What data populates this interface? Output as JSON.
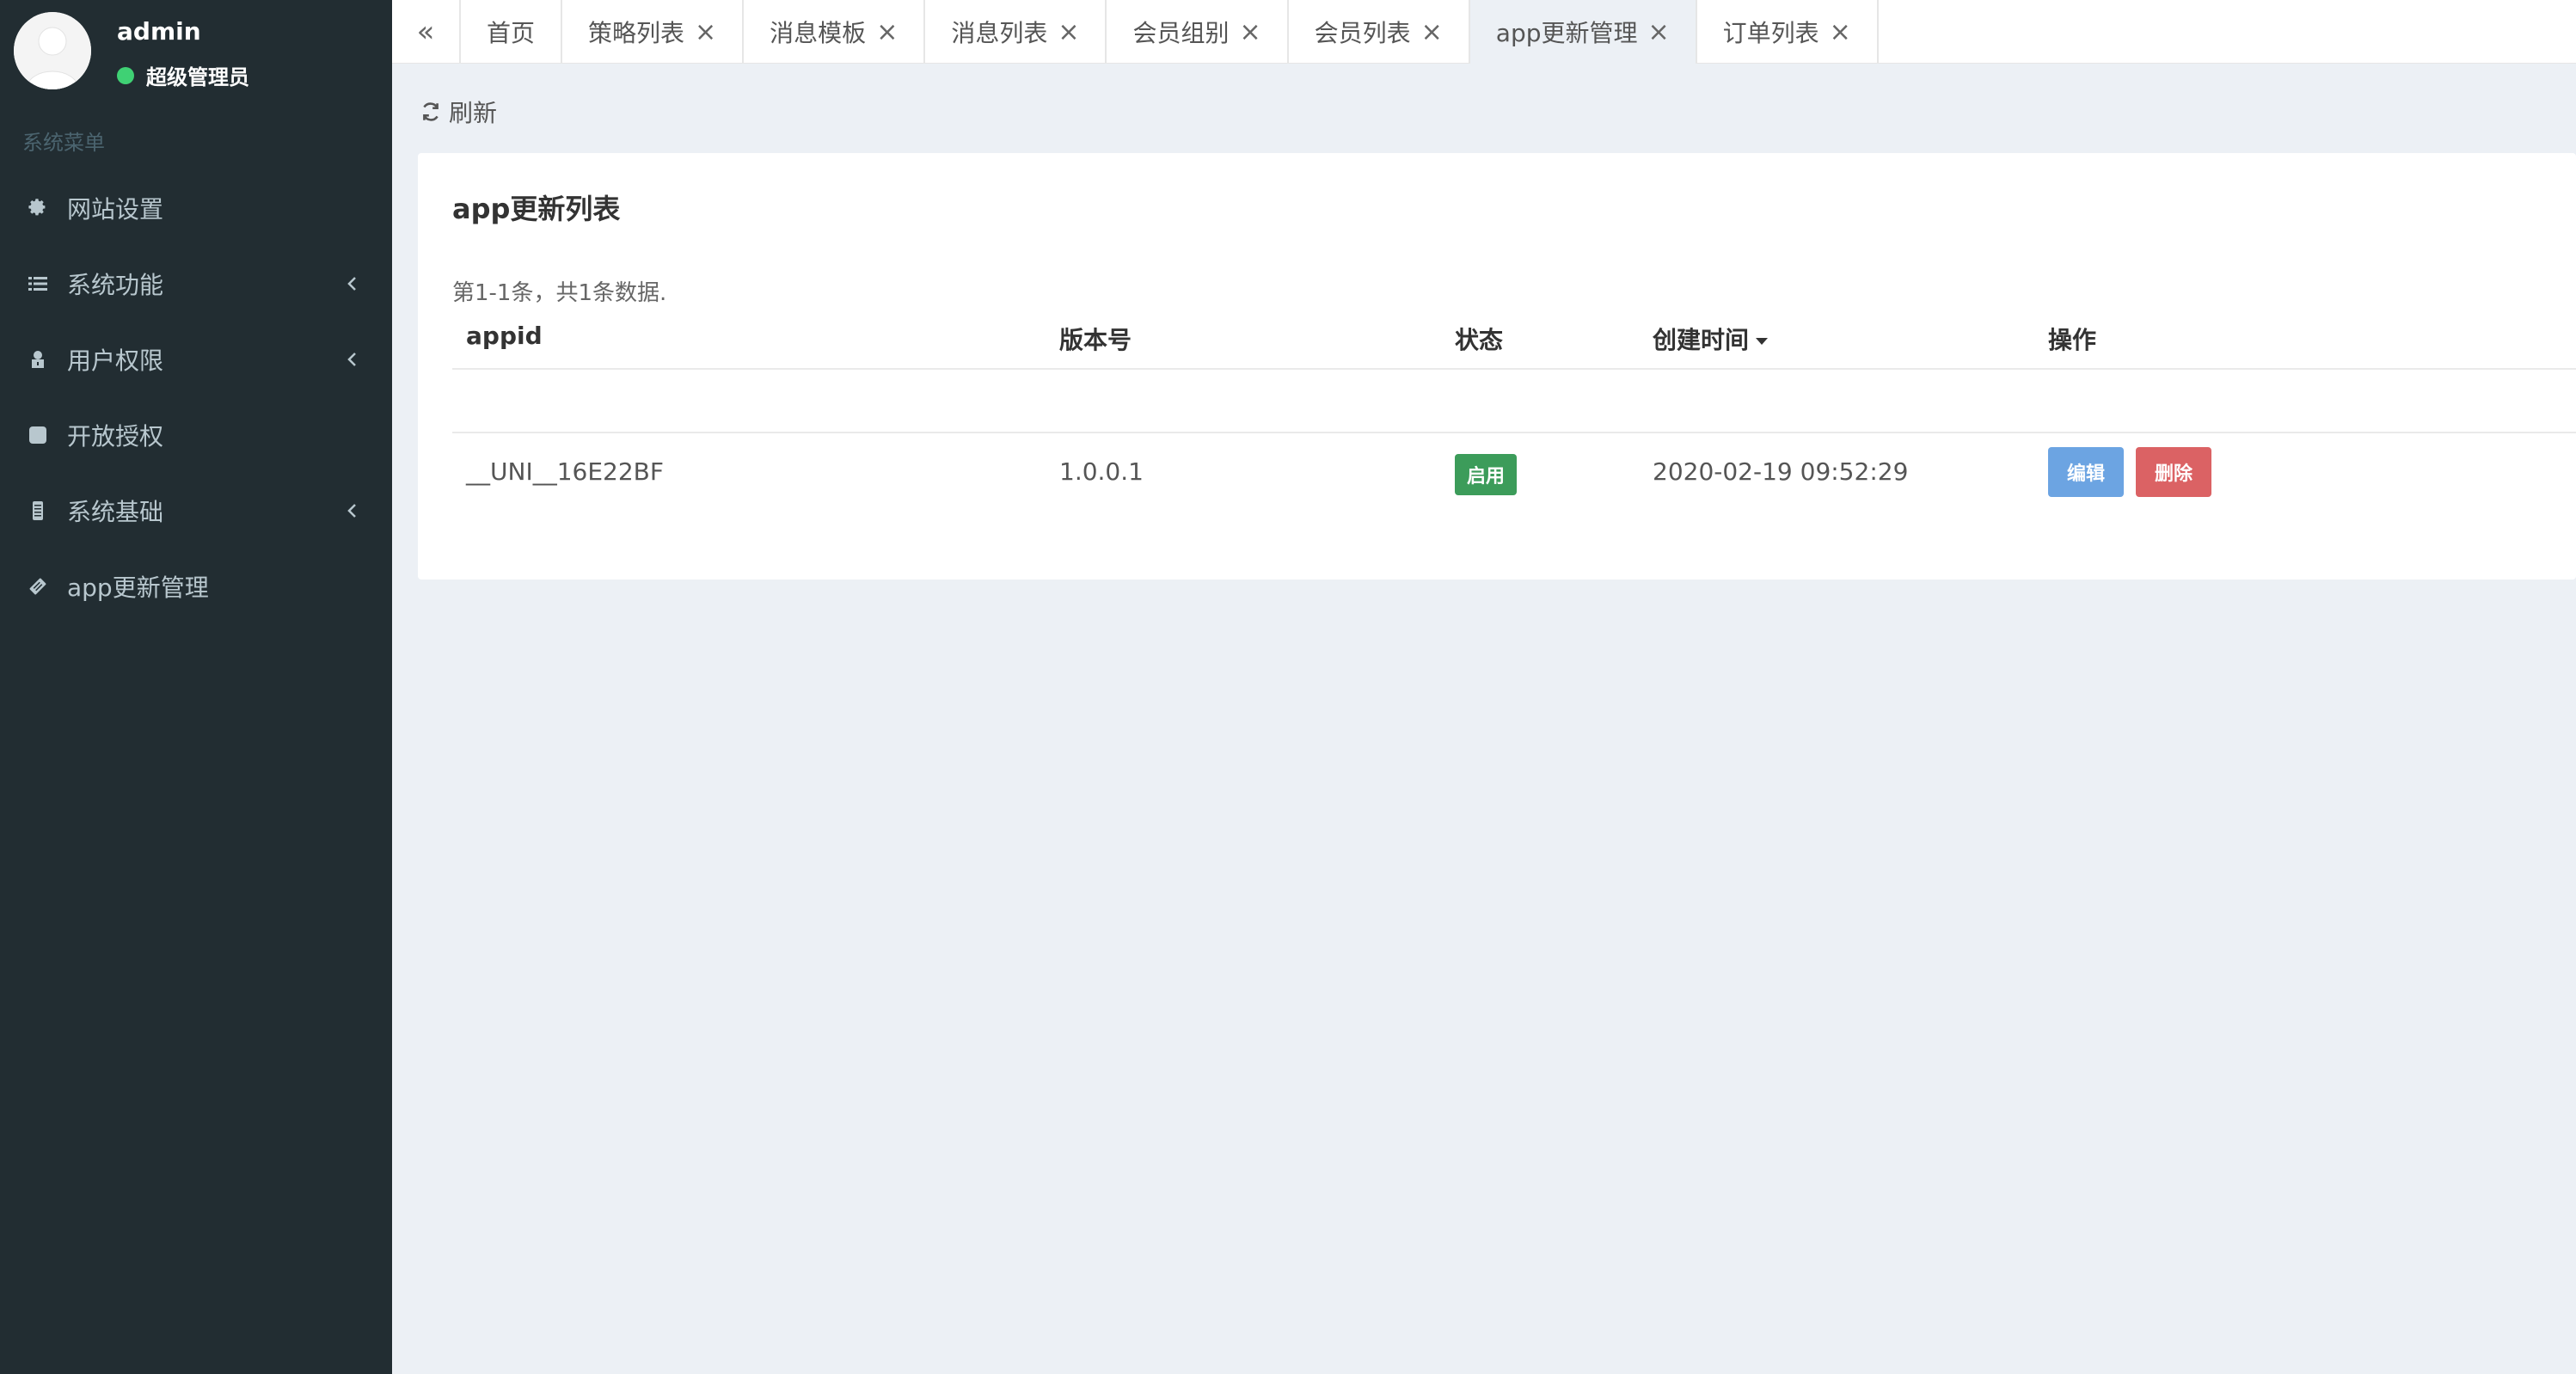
{
  "user": {
    "name": "admin",
    "role": "超级管理员",
    "status_color": "#3fd174"
  },
  "sidebar": {
    "header": "系统菜单",
    "items": [
      {
        "label": "网站设置",
        "icon": "gear-icon",
        "has_submenu": false
      },
      {
        "label": "系统功能",
        "icon": "list-icon",
        "has_submenu": true
      },
      {
        "label": "用户权限",
        "icon": "user-lock-icon",
        "has_submenu": true
      },
      {
        "label": "开放授权",
        "icon": "square-icon",
        "has_submenu": false
      },
      {
        "label": "系统基础",
        "icon": "database-icon",
        "has_submenu": true
      },
      {
        "label": "app更新管理",
        "icon": "ticket-icon",
        "has_submenu": false
      }
    ]
  },
  "tabs": {
    "back_label": "«",
    "items": [
      {
        "label": "首页",
        "closable": false,
        "active": false
      },
      {
        "label": "策略列表",
        "closable": true,
        "active": false
      },
      {
        "label": "消息模板",
        "closable": true,
        "active": false
      },
      {
        "label": "消息列表",
        "closable": true,
        "active": false
      },
      {
        "label": "会员组别",
        "closable": true,
        "active": false
      },
      {
        "label": "会员列表",
        "closable": true,
        "active": false
      },
      {
        "label": "app更新管理",
        "closable": true,
        "active": true
      },
      {
        "label": "订单列表",
        "closable": true,
        "active": false
      }
    ],
    "close_glyph": "×"
  },
  "toolbar": {
    "refresh_label": "刷新"
  },
  "panel": {
    "title": "app更新列表",
    "summary": "第1-1条，共1条数据.",
    "columns": {
      "appid": "appid",
      "version": "版本号",
      "status": "状态",
      "created": "创建时间",
      "actions": "操作"
    },
    "rows": [
      {
        "appid": "__UNI__16E22BF",
        "version": "1.0.0.1",
        "status": "启用",
        "created": "2020-02-19 09:52:29",
        "edit_label": "编辑",
        "delete_label": "删除"
      }
    ]
  },
  "colors": {
    "sidebar_bg": "#222d32",
    "content_bg": "#ecf0f5",
    "badge_success": "#3c9c5a",
    "btn_primary": "#6ca4e2",
    "btn_danger": "#db6264"
  }
}
